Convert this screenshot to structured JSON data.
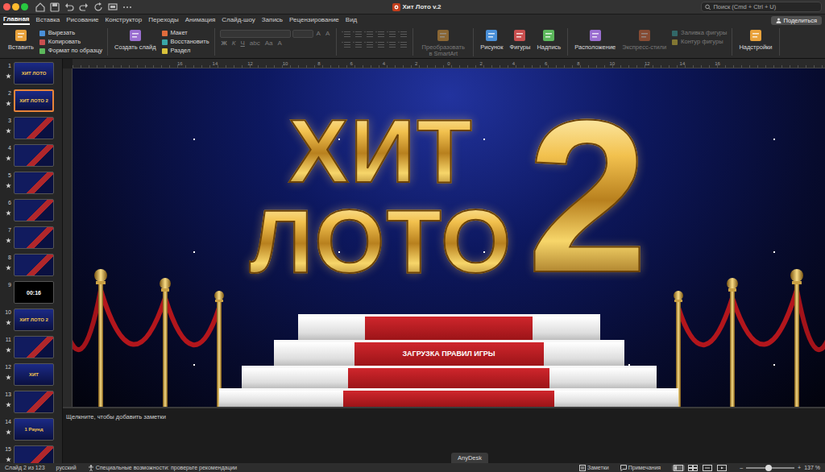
{
  "window": {
    "title": "Хит Лото v.2",
    "search_placeholder": "Поиск (Cmd + Ctrl + U)"
  },
  "share_button": "Поделиться",
  "tabs": [
    {
      "label": "Главная",
      "selected": true
    },
    {
      "label": "Вставка",
      "selected": false
    },
    {
      "label": "Рисование",
      "selected": false
    },
    {
      "label": "Конструктор",
      "selected": false
    },
    {
      "label": "Переходы",
      "selected": false
    },
    {
      "label": "Анимация",
      "selected": false
    },
    {
      "label": "Слайд-шоу",
      "selected": false
    },
    {
      "label": "Запись",
      "selected": false
    },
    {
      "label": "Рецензирование",
      "selected": false
    },
    {
      "label": "Вид",
      "selected": false
    }
  ],
  "ribbon": {
    "groups": [
      {
        "kind": "buttons",
        "columns": [
          [
            {
              "label": "Вставить",
              "kind": "large",
              "disabled": false
            }
          ],
          [
            {
              "label": "Вырезать",
              "kind": "small",
              "disabled": false
            },
            {
              "label": "Копировать",
              "kind": "small",
              "disabled": false
            },
            {
              "label": "Формат по образцу",
              "kind": "small",
              "disabled": false
            }
          ]
        ]
      },
      {
        "kind": "buttons",
        "columns": [
          [
            {
              "label": "Создать слайд",
              "kind": "large",
              "disabled": false
            }
          ],
          [
            {
              "label": "Макет",
              "kind": "small",
              "disabled": false
            },
            {
              "label": "Восстановить",
              "kind": "small",
              "disabled": false
            },
            {
              "label": "Раздел",
              "kind": "small",
              "disabled": false
            }
          ]
        ]
      },
      {
        "kind": "font",
        "disabled": true,
        "rows": [
          [
            "A",
            "A"
          ],
          [
            "Ж",
            "К",
            "Ч",
            "abc",
            "Aa",
            "A"
          ]
        ]
      },
      {
        "kind": "paragraph",
        "disabled": true
      },
      {
        "kind": "buttons",
        "columns": [
          [
            {
              "label": "Преобразовать в SmartArt",
              "kind": "large",
              "disabled": true
            }
          ]
        ]
      },
      {
        "kind": "buttons",
        "columns": [
          [
            {
              "label": "Рисунок",
              "kind": "large",
              "disabled": false
            }
          ],
          [
            {
              "label": "Фигуры",
              "kind": "large",
              "disabled": false
            }
          ],
          [
            {
              "label": "Надпись",
              "kind": "large",
              "disabled": false
            }
          ]
        ]
      },
      {
        "kind": "buttons",
        "columns": [
          [
            {
              "label": "Расположение",
              "kind": "large",
              "disabled": false
            }
          ],
          [
            {
              "label": "Экспресс-стили",
              "kind": "large",
              "disabled": true
            }
          ],
          [
            {
              "label": "Заливка фигуры",
              "kind": "small",
              "disabled": true
            },
            {
              "label": "Контур фигуры",
              "kind": "small",
              "disabled": true
            }
          ]
        ]
      },
      {
        "kind": "buttons",
        "columns": [
          [
            {
              "label": "Надстройки",
              "kind": "large",
              "disabled": false
            }
          ]
        ]
      }
    ]
  },
  "thumbnails": [
    {
      "number": "1",
      "selected": false,
      "animated": true,
      "kind": "title",
      "text": "ХИТ ЛОТО"
    },
    {
      "number": "2",
      "selected": true,
      "animated": true,
      "kind": "title",
      "text": "ХИТ ЛОТО 2"
    },
    {
      "number": "3",
      "selected": false,
      "animated": true,
      "kind": "content"
    },
    {
      "number": "4",
      "selected": false,
      "animated": true,
      "kind": "content"
    },
    {
      "number": "5",
      "selected": false,
      "animated": true,
      "kind": "content"
    },
    {
      "number": "6",
      "selected": false,
      "animated": true,
      "kind": "content"
    },
    {
      "number": "7",
      "selected": false,
      "animated": true,
      "kind": "content"
    },
    {
      "number": "8",
      "selected": false,
      "animated": true,
      "kind": "content"
    },
    {
      "number": "9",
      "selected": false,
      "animated": false,
      "kind": "timer",
      "text": "00:16"
    },
    {
      "number": "10",
      "selected": false,
      "animated": true,
      "kind": "title",
      "text": "ХИТ ЛОТО 2"
    },
    {
      "number": "11",
      "selected": false,
      "animated": true,
      "kind": "content"
    },
    {
      "number": "12",
      "selected": false,
      "animated": true,
      "kind": "title",
      "text": "ХИТ"
    },
    {
      "number": "13",
      "selected": false,
      "animated": true,
      "kind": "content"
    },
    {
      "number": "14",
      "selected": false,
      "animated": true,
      "kind": "title",
      "text": "1 Раунд"
    },
    {
      "number": "15",
      "selected": false,
      "animated": true,
      "kind": "content"
    }
  ],
  "ruler": {
    "labels": [
      "16",
      "14",
      "12",
      "10",
      "8",
      "6",
      "4",
      "2",
      "0",
      "2",
      "4",
      "6",
      "8",
      "10",
      "12",
      "14",
      "16"
    ]
  },
  "slide": {
    "title_lines": [
      "ХИТ",
      "ЛОТО"
    ],
    "number": "2",
    "podium_text": "ЗАГРУЗКА ПРАВИЛ ИГРЫ"
  },
  "notes": {
    "placeholder": "Щелкните, чтобы добавить заметки"
  },
  "overlay_tab": "AnyDesk",
  "status_bar": {
    "slide": "Слайд 2 из 123",
    "language": "русский",
    "accessibility": "Специальные возможности: проверьте рекомендации",
    "notes": "Заметки",
    "comments": "Примечания",
    "views": [
      {
        "selected": true
      },
      {
        "selected": false
      },
      {
        "selected": false
      },
      {
        "selected": false
      }
    ],
    "zoom_minus": "–",
    "zoom_plus": "+",
    "zoom_level": 0.47,
    "zoom": "137 %"
  }
}
